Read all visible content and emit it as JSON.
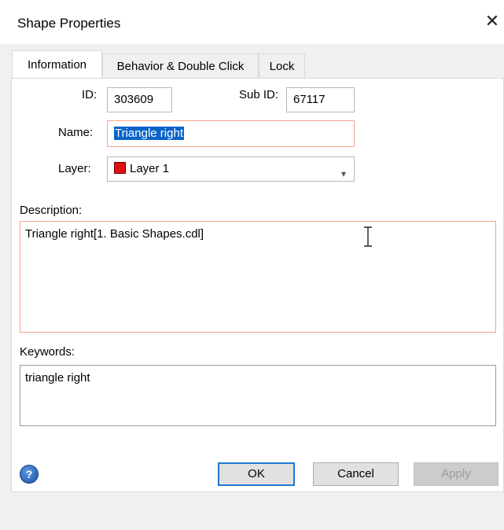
{
  "window": {
    "title": "Shape Properties",
    "close_glyph": "✕"
  },
  "tabs": [
    {
      "label": "Information",
      "active": true
    },
    {
      "label": "Behavior & Double Click",
      "active": false
    },
    {
      "label": "Lock",
      "active": false
    }
  ],
  "info": {
    "id_label": "ID:",
    "id_value": "303609",
    "subid_label": "Sub ID:",
    "subid_value": "67117",
    "name_label": "Name:",
    "name_value": "Triangle right",
    "layer_label": "Layer:",
    "layer_value": "Layer 1",
    "layer_color": "#e01010",
    "description_label": "Description:",
    "description_value": "Triangle right[1. Basic Shapes.cdl]",
    "keywords_label": "Keywords:",
    "keywords_value": "triangle right"
  },
  "buttons": {
    "ok": "OK",
    "cancel": "Cancel",
    "apply": "Apply",
    "help": "?"
  },
  "icons": {
    "help": "help-icon",
    "close": "close-icon",
    "dropdown": "chevron-down-icon",
    "cursor": "text-cursor-icon"
  }
}
